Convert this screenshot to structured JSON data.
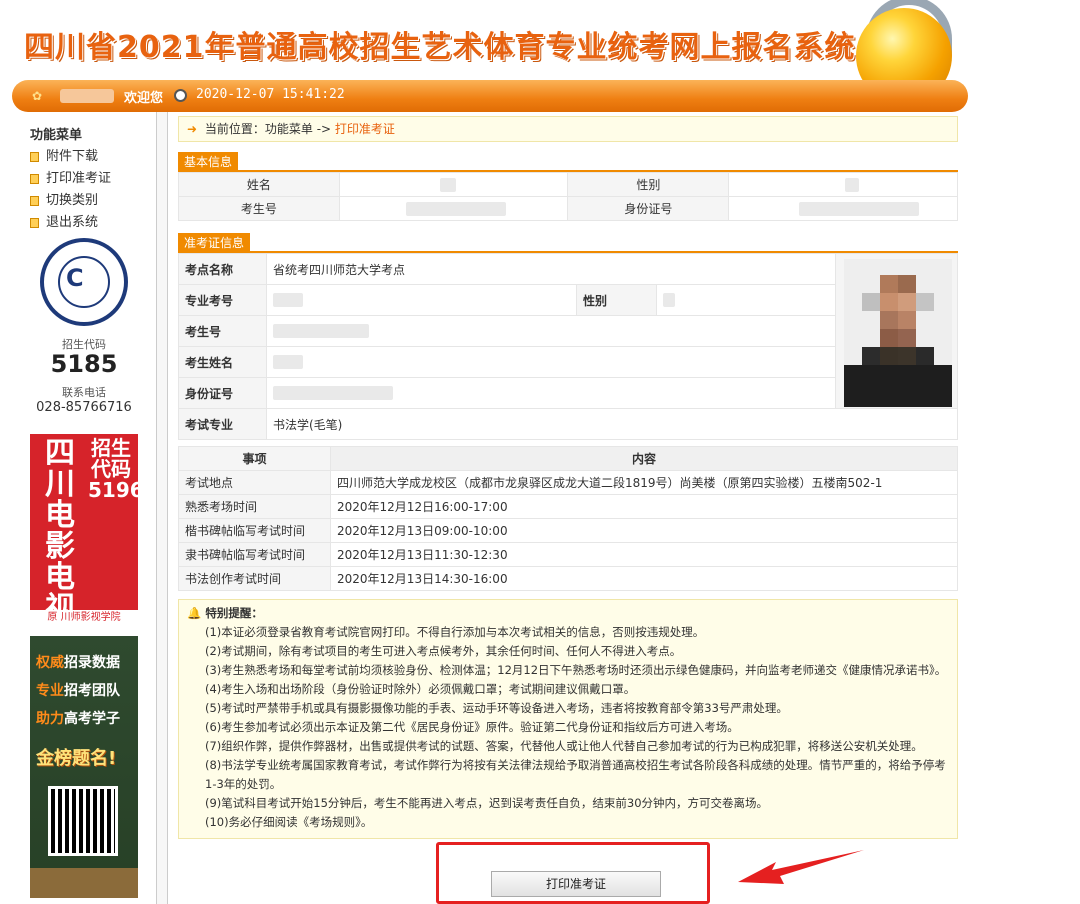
{
  "header": {
    "site_title": "四川省2021年普通高校招生艺术体育专业统考网上报名系统",
    "welcome": "欢迎您",
    "datetime": "2020-12-07 15:41:22"
  },
  "sidebar": {
    "title": "功能菜单",
    "items": [
      {
        "label": "附件下载"
      },
      {
        "label": "打印准考证"
      },
      {
        "label": "切换类别"
      },
      {
        "label": "退出系统"
      }
    ],
    "ad1": {
      "code_label": "招生代码",
      "code": "5185",
      "phone_label": "联系电话",
      "phone": "028-85766716"
    },
    "ad2": {
      "left_text": "四川电影电视学院",
      "right_text": "招生代码5196",
      "bottom": "原 川师影视学院"
    },
    "ad3": {
      "line1a": "权威",
      "line1b": "招录数据",
      "line2a": "专业",
      "line2b": "招考团队",
      "line3a": "助力",
      "line3b": "高考学子",
      "line4": "金榜题名!"
    }
  },
  "breadcrumb": {
    "prefix": "当前位置：功能菜单 ->",
    "current": "打印准考证"
  },
  "basic_info": {
    "section_title": "基本信息",
    "name_label": "姓名",
    "gender_label": "性别",
    "examinee_no_label": "考生号",
    "id_label": "身份证号"
  },
  "ticket": {
    "section_title": "准考证信息",
    "site_label": "考点名称",
    "site_value": "省统考四川师范大学考点",
    "major_no_label": "专业考号",
    "gender_label": "性别",
    "examinee_no_label": "考生号",
    "name_label": "考生姓名",
    "id_label": "身份证号",
    "major_label": "考试专业",
    "major_value": "书法学(毛笔)"
  },
  "schedule": {
    "col_item": "事项",
    "col_content": "内容",
    "rows": [
      {
        "item": "考试地点",
        "content": "四川师范大学成龙校区（成都市龙泉驿区成龙大道二段1819号）尚美楼（原第四实验楼）五楼南502-1"
      },
      {
        "item": "熟悉考场时间",
        "content": "2020年12月12日16:00-17:00"
      },
      {
        "item": "楷书碑帖临写考试时间",
        "content": "2020年12月13日09:00-10:00"
      },
      {
        "item": "隶书碑帖临写考试时间",
        "content": "2020年12月13日11:30-12:30"
      },
      {
        "item": "书法创作考试时间",
        "content": "2020年12月13日14:30-16:00"
      }
    ]
  },
  "notes": {
    "title": "特别提醒：",
    "items": [
      "(1)本证必须登录省教育考试院官网打印。不得自行添加与本次考试相关的信息，否则按违规处理。",
      "(2)考试期间，除有考试项目的考生可进入考点候考外，其余任何时间、任何人不得进入考点。",
      "(3)考生熟悉考场和每堂考试前均须核验身份、检测体温；12月12日下午熟悉考场时还须出示绿色健康码，并向监考老师递交《健康情况承诺书》。",
      "(4)考生入场和出场阶段（身份验证时除外）必须佩戴口罩；考试期间建议佩戴口罩。",
      "(5)考试时严禁带手机或具有摄影摄像功能的手表、运动手环等设备进入考场，违者将按教育部令第33号严肃处理。",
      "(6)考生参加考试必须出示本证及第二代《居民身份证》原件。验证第二代身份证和指纹后方可进入考场。",
      "(7)组织作弊，提供作弊器材，出售或提供考试的试题、答案，代替他人或让他人代替自己参加考试的行为已构成犯罪，将移送公安机关处理。",
      "(8)书法学专业统考属国家教育考试，考试作弊行为将按有关法律法规给予取消普通高校招生考试各阶段各科成绩的处理。情节严重的，将给予停考1-3年的处罚。",
      "(9)笔试科目考试开始15分钟后，考生不能再进入考点，迟到误考责任自负，结束前30分钟内，方可交卷离场。",
      "(10)务必仔细阅读《考场规则》。"
    ]
  },
  "print_button": "打印准考证",
  "colors": {
    "accent": "#f08a00",
    "title": "#e8620f",
    "highlight_box": "#e52020"
  }
}
